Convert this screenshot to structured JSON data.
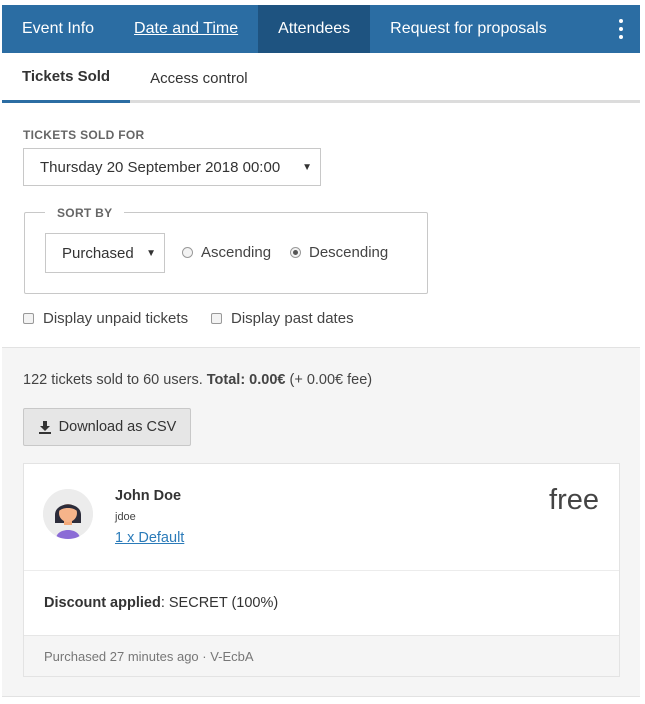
{
  "topnav": {
    "tabs": [
      {
        "label": "Event Info"
      },
      {
        "label": "Date and Time"
      },
      {
        "label": "Attendees"
      },
      {
        "label": "Request for proposals"
      }
    ],
    "active": "Attendees",
    "menu_icon": "kebab-vertical-icon",
    "colors": {
      "bar": "#2b6da3",
      "active": "#1e5380"
    }
  },
  "subtabs": {
    "items": [
      {
        "label": "Tickets Sold"
      },
      {
        "label": "Access control"
      }
    ],
    "active": "Tickets Sold"
  },
  "filters": {
    "tickets_sold_for_label": "TICKETS SOLD FOR",
    "date_select_value": "Thursday 20 September 2018 00:00",
    "sort_by_label": "SORT BY",
    "sort_select_value": "Purchased",
    "sort_order": {
      "ascending_label": "Ascending",
      "descending_label": "Descending",
      "selected": "Descending"
    },
    "unpaid_label": "Display unpaid tickets",
    "unpaid_checked": false,
    "past_dates_label": "Display past dates",
    "past_dates_checked": false
  },
  "results": {
    "summary_prefix": "122 tickets sold to 60 users. ",
    "summary_total_label": "Total: 0.00€",
    "summary_suffix": " (+ 0.00€ fee)",
    "download_label": "Download as CSV",
    "download_icon": "download-icon"
  },
  "attendee": {
    "name": "John Doe",
    "username": "jdoe",
    "ticket_link": "1 x Default",
    "price": "free",
    "discount_label": "Discount applied",
    "discount_value": ": SECRET (100%)",
    "footer": "Purchased 27 minutes ago · V-EcbA",
    "avatar_icon": "user-avatar-icon"
  }
}
